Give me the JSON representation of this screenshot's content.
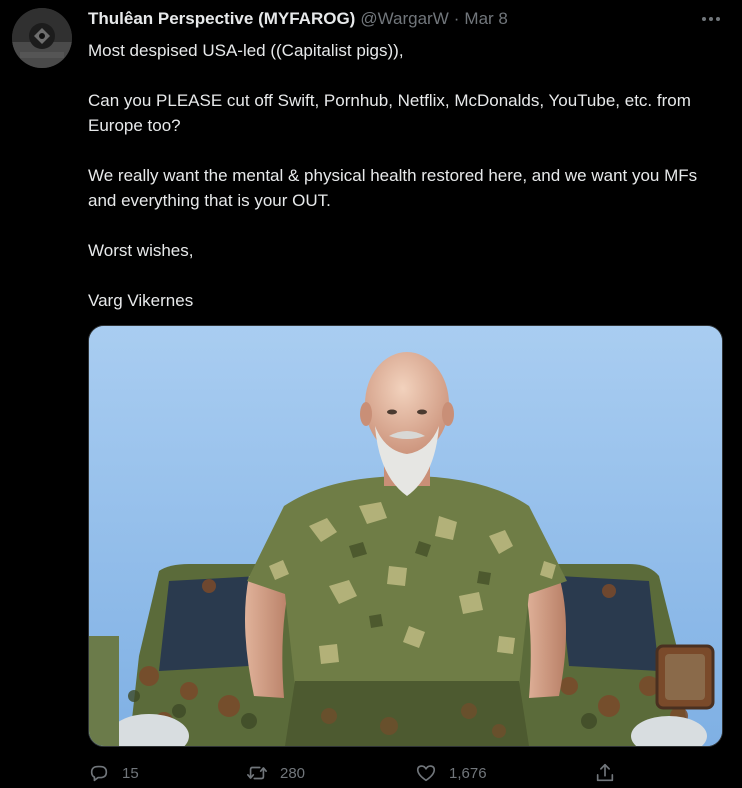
{
  "tweet": {
    "author": {
      "display_name": "Thulêan Perspective (MYFAROG)",
      "handle": "@WargarW",
      "separator": "·",
      "date": "Mar 8"
    },
    "body": [
      "Most despised USA-led ((Capitalist pigs)),",
      "Can you PLEASE cut off Swift, Pornhub, Netflix, McDonalds, YouTube, etc. from Europe too?",
      "We really want the mental & physical health restored here, and we want you MFs and everything that is your OUT.",
      "Worst wishes,",
      "Varg Vikernes"
    ],
    "actions": {
      "reply_count": "15",
      "retweet_count": "280",
      "like_count": "1,676"
    }
  },
  "icons": {
    "more": "more-horizontal-icon",
    "reply": "reply-icon",
    "retweet": "retweet-icon",
    "like": "heart-icon",
    "share": "share-icon"
  },
  "colors": {
    "background": "#000000",
    "text_primary": "#e7e9ea",
    "text_secondary": "#71767b",
    "border": "#2f3336"
  }
}
